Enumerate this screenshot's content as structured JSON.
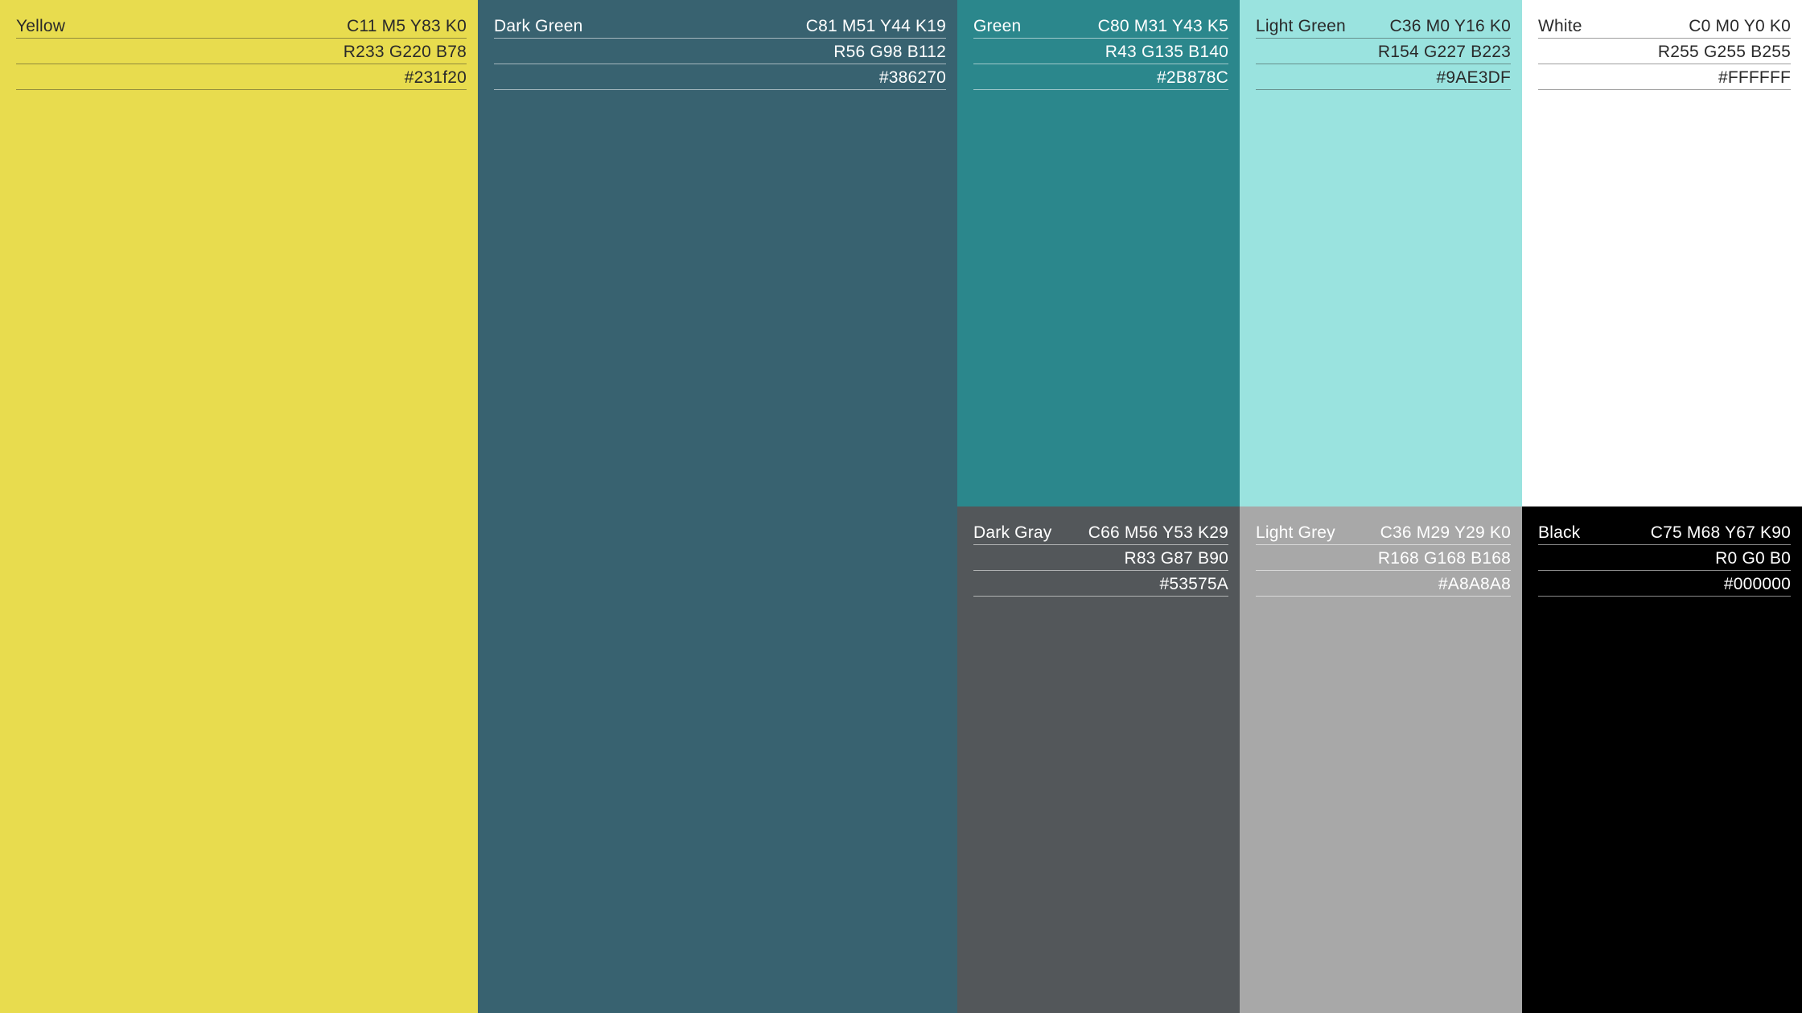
{
  "swatches": [
    {
      "name": "Yellow",
      "cmyk": "C11 M5 Y83 K0",
      "rgb": "R233 G220 B78",
      "hex": "#231f20",
      "fill": "#E8DC4E"
    },
    {
      "name": "Dark Green",
      "cmyk": "C81 M51 Y44 K19",
      "rgb": "R56 G98 B112",
      "hex": "#386270",
      "fill": "#386270"
    },
    {
      "name": "Green",
      "cmyk": "C80 M31 Y43 K5",
      "rgb": "R43 G135 B140",
      "hex": "#2B878C",
      "fill": "#2B878C"
    },
    {
      "name": "Light Green",
      "cmyk": "C36 M0 Y16 K0",
      "rgb": "R154 G227 B223",
      "hex": "#9AE3DF",
      "fill": "#9AE3DF"
    },
    {
      "name": "White",
      "cmyk": "C0 M0 Y0 K0",
      "rgb": "R255 G255 B255",
      "hex": "#FFFFFF",
      "fill": "#FFFFFF"
    },
    {
      "name": "Dark Gray",
      "cmyk": "C66 M56 Y53 K29",
      "rgb": "R83 G87 B90",
      "hex": "#53575A",
      "fill": "#53575A"
    },
    {
      "name": "Light Grey",
      "cmyk": "C36 M29 Y29 K0",
      "rgb": "R168 G168 B168",
      "hex": "#A8A8A8",
      "fill": "#A8A8A8"
    },
    {
      "name": "Black",
      "cmyk": "C75 M68 Y67 K90",
      "rgb": "R0 G0 B0",
      "hex": "#000000",
      "fill": "#000000"
    }
  ]
}
